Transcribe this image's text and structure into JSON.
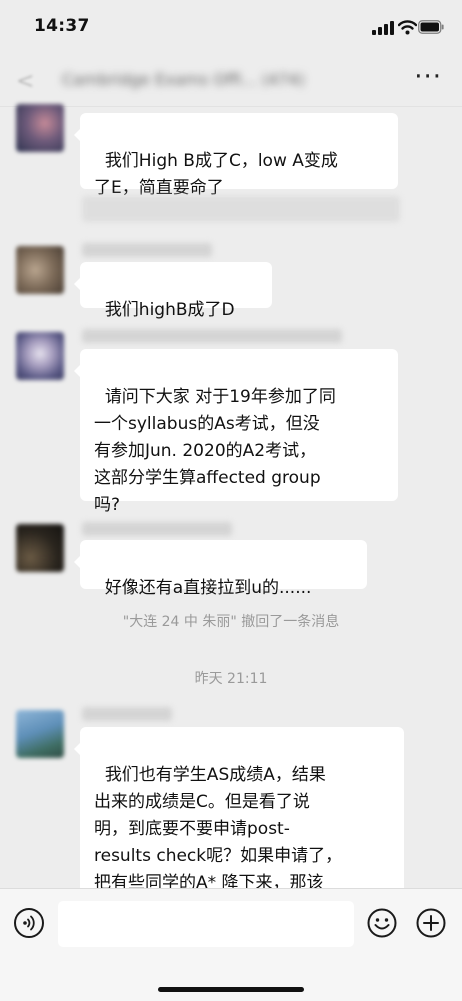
{
  "status_bar": {
    "time": "14:37"
  },
  "nav": {
    "title": "Cambridge Exams Offi... (474)",
    "more_label": "···"
  },
  "messages": [
    {
      "text": "我们High B成了C，low A变成\n了E，简直要命了"
    },
    {
      "text": "我们highB成了D"
    },
    {
      "text": "请问下大家 对于19年参加了同\n一个syllabus的As考试，但没\n有参加Jun. 2020的A2考试，\n这部分学生算affected group\n吗?"
    },
    {
      "text": "好像还有a直接拉到u的......"
    },
    {
      "text": "我们也有学生AS成绩A，结果\n出来的成绩是C。但是看了说\n明，到底要不要申请post-\nresults check呢？如果申请了，\n把有些同学的A* 降下来，那该\n怎么办？"
    }
  ],
  "system": {
    "recall_notice": "\"大连 24 中 朱丽\" 撤回了一条消息",
    "timestamp": "昨天 21:11"
  },
  "colors": {
    "background": "#ededed",
    "bubble": "#ffffff",
    "system_text": "#9a9a9a"
  },
  "icons": [
    "signal-icon",
    "wifi-icon",
    "battery-icon",
    "back-icon",
    "more-icon",
    "voice-icon",
    "emoji-icon",
    "plus-icon"
  ]
}
